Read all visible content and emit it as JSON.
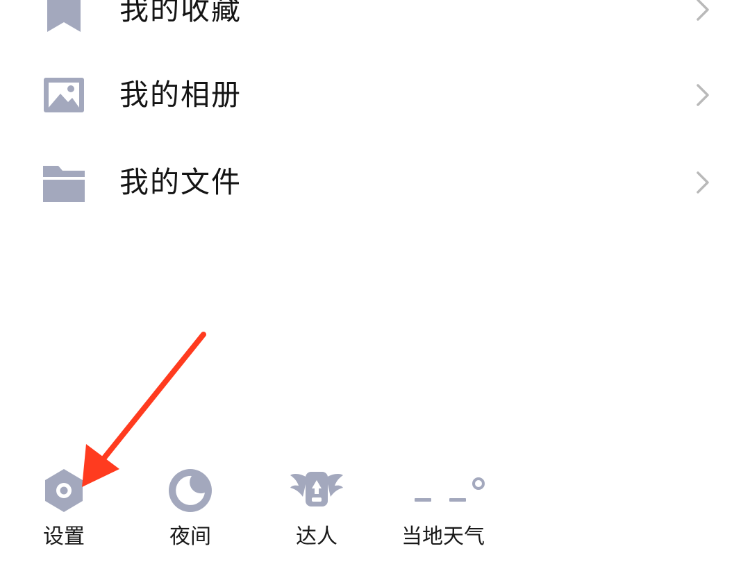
{
  "menu": {
    "items": [
      {
        "label": "我的收藏",
        "icon": "bookmark-icon"
      },
      {
        "label": "我的相册",
        "icon": "image-icon"
      },
      {
        "label": "我的文件",
        "icon": "folder-icon"
      }
    ]
  },
  "shortcuts": {
    "items": [
      {
        "label": "设置",
        "icon": "gear-icon"
      },
      {
        "label": "夜间",
        "icon": "moon-icon"
      },
      {
        "label": "达人",
        "icon": "winged-badge-icon"
      },
      {
        "label": "当地天气",
        "icon": "weather-temperature-icon"
      }
    ],
    "weather_value": "– –°"
  },
  "colors": {
    "icon_gray": "#a3a8bd",
    "text": "#141414",
    "chevron": "#b9b9b9",
    "arrow": "#ff3b1f",
    "background": "#ffffff"
  },
  "annotation": {
    "type": "arrow",
    "color": "#ff3b1f",
    "target": "设置"
  }
}
